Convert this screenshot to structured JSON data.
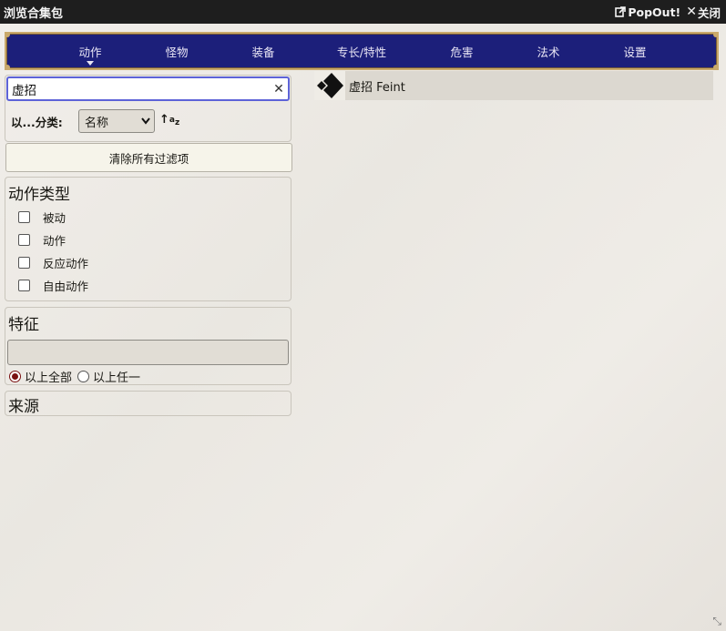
{
  "window": {
    "title": "浏览合集包",
    "popout_label": "PopOut!",
    "close_label": "关闭"
  },
  "nav": {
    "tabs": [
      {
        "label": "动作",
        "active": true
      },
      {
        "label": "怪物"
      },
      {
        "label": "装备"
      },
      {
        "label": "专长/特性"
      },
      {
        "label": "危害"
      },
      {
        "label": "法术"
      },
      {
        "label": "设置"
      }
    ],
    "colors": {
      "bg": "#1c1f7a",
      "border": "#c9a96b"
    }
  },
  "search": {
    "value": "虚招",
    "clear_icon": "close-icon"
  },
  "sort": {
    "label": "以...分类:",
    "selected": "名称",
    "direction_icon": "sort-asc-icon"
  },
  "clear_filters": {
    "label": "清除所有过滤项"
  },
  "action_type": {
    "title": "动作类型",
    "options": [
      "被动",
      "动作",
      "反应动作",
      "自由动作"
    ]
  },
  "traits": {
    "title": "特征",
    "input_value": "",
    "mode_all_label": "以上全部",
    "mode_any_label": "以上任一",
    "selected_mode": "all"
  },
  "source": {
    "title": "来源"
  },
  "results": [
    {
      "name": "虚招 Feint",
      "icon": "single-action-icon"
    }
  ]
}
